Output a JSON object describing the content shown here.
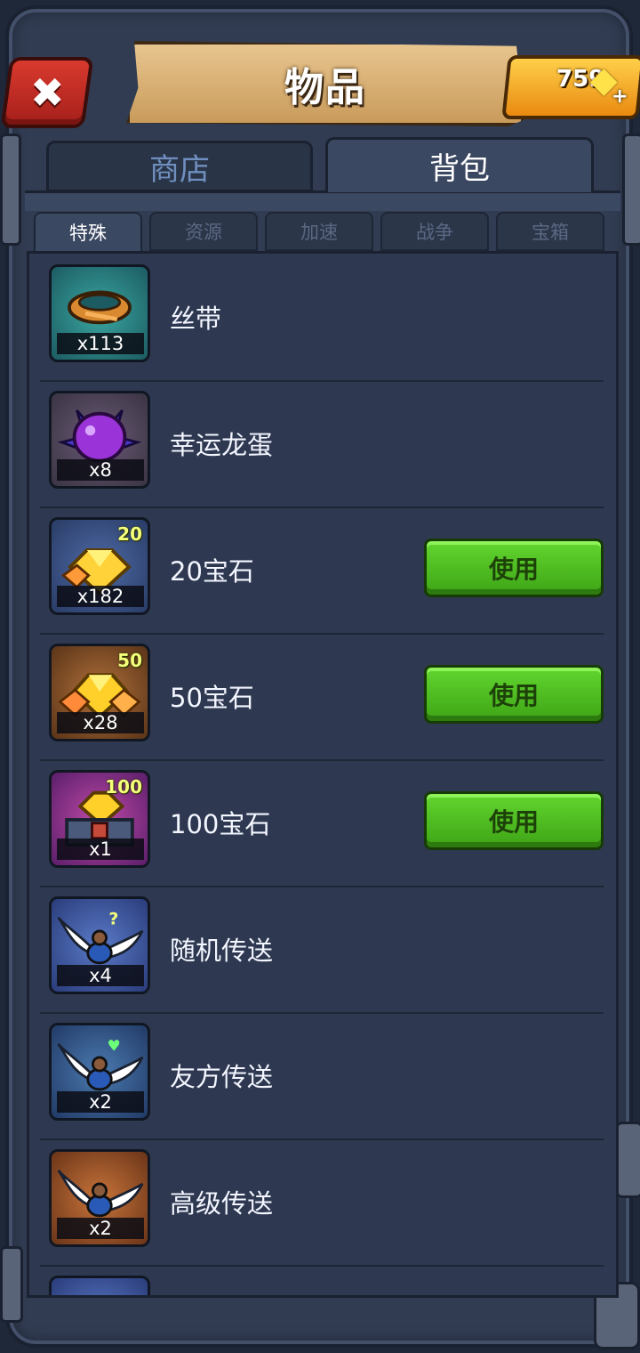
{
  "header": {
    "title": "物品",
    "gems": "759",
    "close_label": "✖"
  },
  "tabs": [
    {
      "label": "商店"
    },
    {
      "label": "背包"
    }
  ],
  "subtabs": [
    {
      "label": "特殊"
    },
    {
      "label": "资源"
    },
    {
      "label": "加速"
    },
    {
      "label": "战争"
    },
    {
      "label": "宝箱"
    }
  ],
  "items": [
    {
      "name": "丝带",
      "qty": "x113",
      "badge": "",
      "action": ""
    },
    {
      "name": "幸运龙蛋",
      "qty": "x8",
      "badge": "",
      "action": ""
    },
    {
      "name": "20宝石",
      "qty": "x182",
      "badge": "20",
      "action": "使用"
    },
    {
      "name": "50宝石",
      "qty": "x28",
      "badge": "50",
      "action": "使用"
    },
    {
      "name": "100宝石",
      "qty": "x1",
      "badge": "100",
      "action": "使用"
    },
    {
      "name": "随机传送",
      "qty": "x4",
      "badge": "",
      "action": ""
    },
    {
      "name": "友方传送",
      "qty": "x2",
      "badge": "",
      "action": ""
    },
    {
      "name": "高级传送",
      "qty": "x2",
      "badge": "",
      "action": ""
    }
  ],
  "colors": {
    "accent_green": "#4cbc1f",
    "gem_gold": "#ffd23a",
    "panel": "#2e3850"
  }
}
